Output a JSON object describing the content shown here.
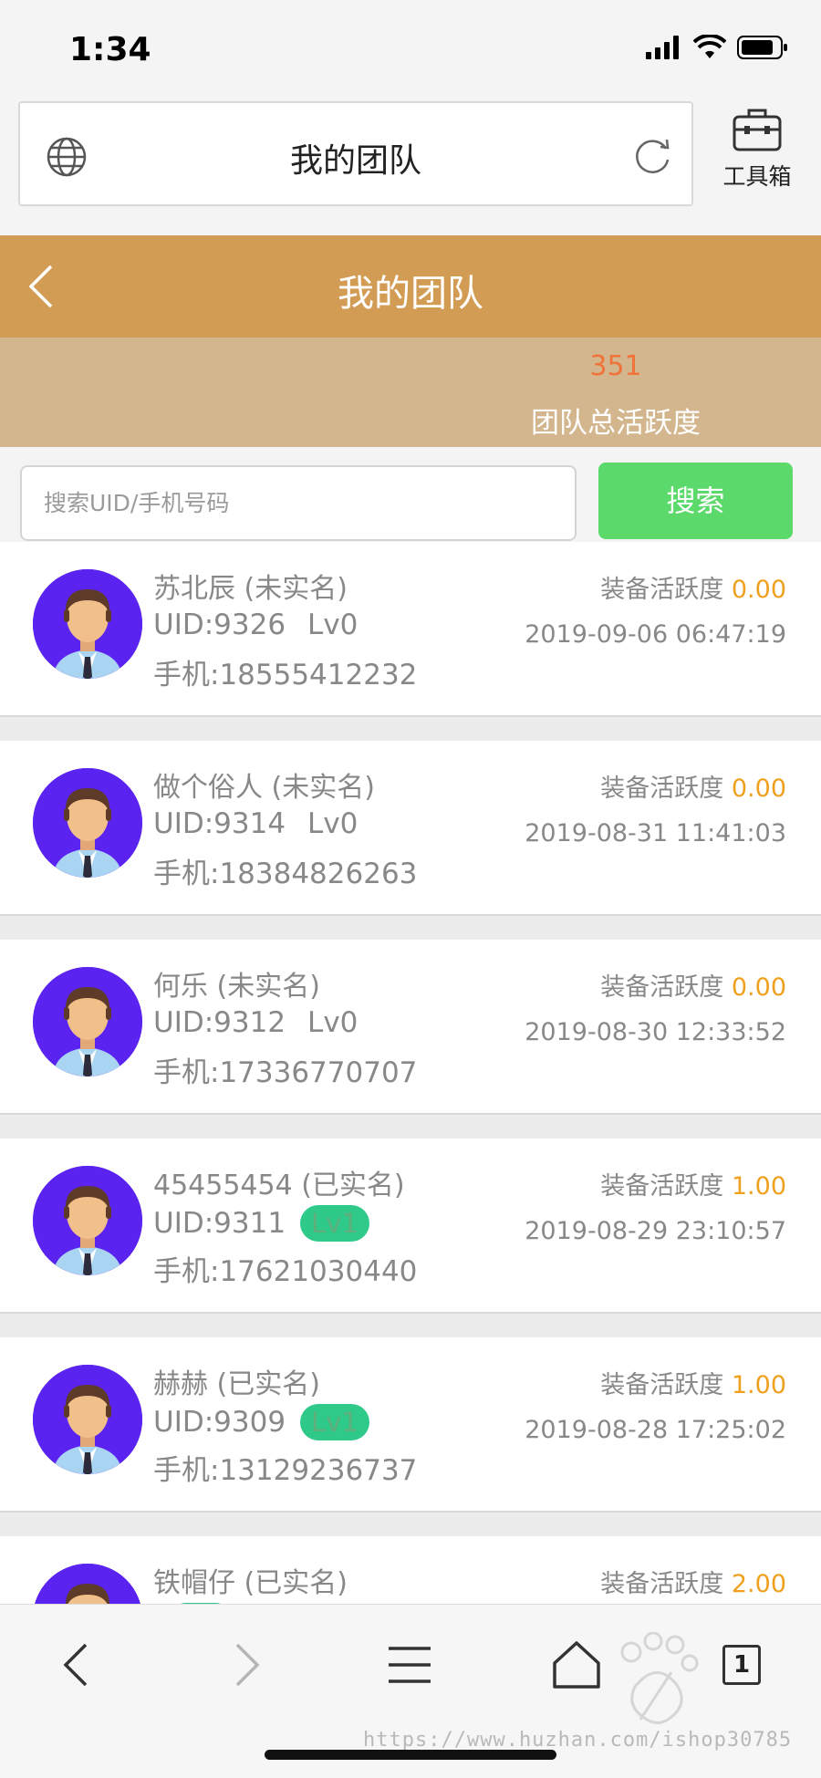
{
  "status_bar": {
    "time": "1:34"
  },
  "browser": {
    "page_title": "我的团队",
    "toolbox_label": "工具箱"
  },
  "header": {
    "title": "我的团队"
  },
  "summary": {
    "total_activity_value": "351",
    "total_activity_label": "团队总活跃度"
  },
  "search": {
    "placeholder": "搜索UID/手机号码",
    "button_label": "搜索"
  },
  "members": [
    {
      "name": "苏北辰 (未实名)",
      "uid": "UID:9326",
      "level": "Lv0",
      "level_badge": false,
      "phone": "手机:18555412232",
      "activity_label": "装备活跃度",
      "activity_value": "0.00",
      "date": "2019-09-06 06:47:19"
    },
    {
      "name": "做个俗人 (未实名)",
      "uid": "UID:9314",
      "level": "Lv0",
      "level_badge": false,
      "phone": "手机:18384826263",
      "activity_label": "装备活跃度",
      "activity_value": "0.00",
      "date": "2019-08-31 11:41:03"
    },
    {
      "name": "何乐 (未实名)",
      "uid": "UID:9312",
      "level": "Lv0",
      "level_badge": false,
      "phone": "手机:17336770707",
      "activity_label": "装备活跃度",
      "activity_value": "0.00",
      "date": "2019-08-30 12:33:52"
    },
    {
      "name": "45455454 (已实名)",
      "uid": "UID:9311",
      "level": "Lv1",
      "level_badge": true,
      "phone": "手机:17621030440",
      "activity_label": "装备活跃度",
      "activity_value": "1.00",
      "date": "2019-08-29 23:10:57"
    },
    {
      "name": "赫赫 (已实名)",
      "uid": "UID:9309",
      "level": "Lv1",
      "level_badge": true,
      "phone": "手机:13129236737",
      "activity_label": "装备活跃度",
      "activity_value": "1.00",
      "date": "2019-08-28 17:25:02"
    },
    {
      "name": "铁帽仔 (已实名)",
      "uid": "",
      "level": "",
      "level_badge": true,
      "phone": "",
      "activity_label": "装备活跃度",
      "activity_value": "2.00",
      "date": ""
    }
  ],
  "bottom_bar": {
    "tab_count": "1",
    "watermark": "https://www.huzhan.com/ishop30785"
  },
  "colors": {
    "header_bg": "#d29c55",
    "summary_bg": "#d3b68e",
    "search_button": "#5cd96b",
    "avatar_bg": "#5a23f0",
    "activity_value": "#f0a01e",
    "level_badge": "#2fc98a"
  },
  "icons": [
    "globe-icon",
    "reload-icon",
    "toolbox-icon",
    "back-icon",
    "forward-icon",
    "menu-icon",
    "home-icon",
    "tabs-icon"
  ]
}
